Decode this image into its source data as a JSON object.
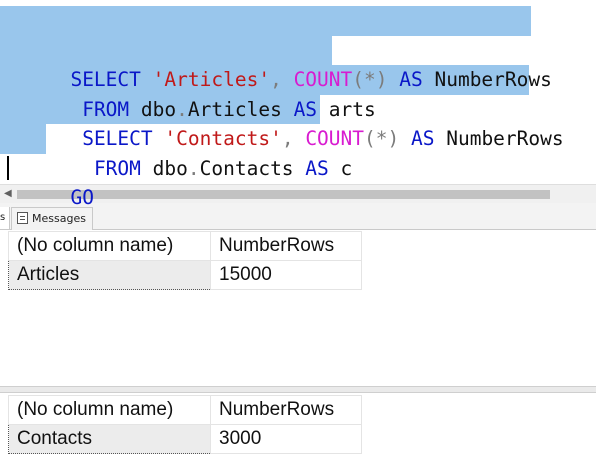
{
  "editor": {
    "lines": [
      [
        {
          "t": "SELECT",
          "c": "kw"
        },
        {
          "t": " ",
          "c": "id"
        },
        {
          "t": "'Articles'",
          "c": "str"
        },
        {
          "t": ",",
          "c": "gr"
        },
        {
          "t": " ",
          "c": "id"
        },
        {
          "t": "COUNT",
          "c": "fn"
        },
        {
          "t": "(*)",
          "c": "gr"
        },
        {
          "t": " ",
          "c": "id"
        },
        {
          "t": "AS",
          "c": "kw"
        },
        {
          "t": " NumberRows",
          "c": "id"
        }
      ],
      [
        {
          "t": " ",
          "c": "id"
        },
        {
          "t": "FROM",
          "c": "kw"
        },
        {
          "t": " dbo",
          "c": "id"
        },
        {
          "t": ".",
          "c": "gr"
        },
        {
          "t": "Articles ",
          "c": "id"
        },
        {
          "t": "AS",
          "c": "kw"
        },
        {
          "t": " arts",
          "c": "id"
        }
      ],
      [
        {
          "t": " ",
          "c": "id"
        },
        {
          "t": "SELECT",
          "c": "kw"
        },
        {
          "t": " ",
          "c": "id"
        },
        {
          "t": "'Contacts'",
          "c": "str"
        },
        {
          "t": ",",
          "c": "gr"
        },
        {
          "t": " ",
          "c": "id"
        },
        {
          "t": "COUNT",
          "c": "fn"
        },
        {
          "t": "(*)",
          "c": "gr"
        },
        {
          "t": " ",
          "c": "id"
        },
        {
          "t": "AS",
          "c": "kw"
        },
        {
          "t": " NumberRows",
          "c": "id"
        }
      ],
      [
        {
          "t": "  ",
          "c": "id"
        },
        {
          "t": "FROM",
          "c": "kw"
        },
        {
          "t": " dbo",
          "c": "id"
        },
        {
          "t": ".",
          "c": "gr"
        },
        {
          "t": "Contacts ",
          "c": "id"
        },
        {
          "t": "AS",
          "c": "kw"
        },
        {
          "t": " c",
          "c": "id"
        }
      ],
      [
        {
          "t": "GO",
          "c": "kw"
        }
      ]
    ]
  },
  "tabs": {
    "partial_label": "s",
    "messages_label": "Messages"
  },
  "results": [
    {
      "headers": [
        "(No column name)",
        "NumberRows"
      ],
      "rows": [
        [
          "Articles",
          "15000"
        ]
      ]
    },
    {
      "headers": [
        "(No column name)",
        "NumberRows"
      ],
      "rows": [
        [
          "Contacts",
          "3000"
        ]
      ]
    }
  ]
}
